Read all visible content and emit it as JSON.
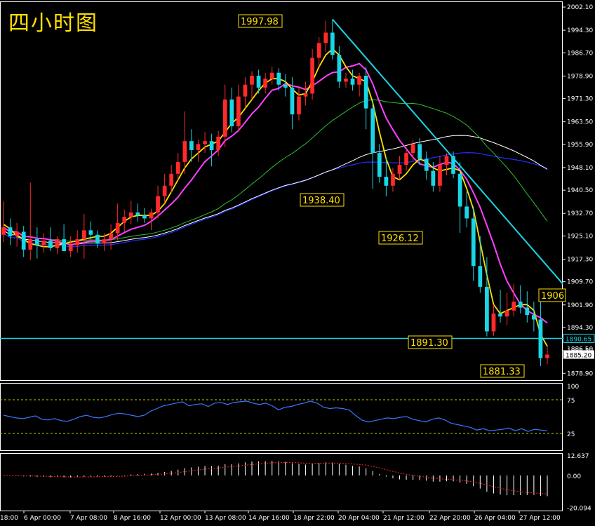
{
  "title": "四小时图",
  "chart_data": {
    "type": "candlestick",
    "timeframe": "4H",
    "main_panel": {
      "y_ticks": [
        2002.1,
        1994.3,
        1986.7,
        1978.9,
        1971.3,
        1963.5,
        1955.9,
        1948.1,
        1940.5,
        1932.7,
        1925.1,
        1917.3,
        1909.7,
        1901.9,
        1894.3,
        1886.5,
        1878.9
      ],
      "y_tick_labels": [
        "2002.10",
        "1994.30",
        "1986.70",
        "1978.90",
        "1971.30",
        "1963.50",
        "1955.90",
        "1948.10",
        "1940.50",
        "1932.70",
        "1925.10",
        "1917.30",
        "1909.70",
        "1901.90",
        "1894.30",
        "1886.50",
        "1878.90"
      ],
      "ylim": [
        1876.6,
        2004.0
      ],
      "x_labels": [
        "6 Apr 00:00",
        "7 Apr 08:00",
        "8 Apr 16:00",
        "12 Apr 00:00",
        "13 Apr 08:00",
        "14 Apr 16:00",
        "18 Apr 22:00",
        "20 Apr 04:00",
        "21 Apr 12:00",
        "22 Apr 20:00",
        "26 Apr 04:00",
        "27 Apr 12:00"
      ],
      "x_label_partial": "18:00",
      "current_price": 1885.2,
      "current_price_label": "1885.20",
      "partial_label": "1886.50",
      "support_line": {
        "value": 1890.65,
        "label": "1890.65"
      },
      "annotations": [
        {
          "label": "1997.98",
          "value": 1997.98
        },
        {
          "label": "1938.40",
          "value": 1938.4
        },
        {
          "label": "1926.12",
          "value": 1926.12
        },
        {
          "label": "1891.30",
          "value": 1891.3
        },
        {
          "label": "1881.33",
          "value": 1881.33
        },
        {
          "label": "1906",
          "value": 1906.5
        }
      ],
      "trendline": {
        "from": 1997.98,
        "to": 1909.0
      },
      "colors": {
        "up": "#ff2a2a",
        "down": "#19d6e6",
        "ma_short": "#ffe000",
        "ma_mid": "#ff40ff",
        "ma_long1": "#2fbf2f",
        "ma_long2": "#ffffff",
        "ma_long3": "#2030ff",
        "trendline": "#19d6e6"
      },
      "candles": [
        [
          1925.5,
          1936.8,
          1923,
          1928
        ],
        [
          1928,
          1931,
          1922,
          1925
        ],
        [
          1925,
          1929.5,
          1921.5,
          1926.5
        ],
        [
          1926.5,
          1928.5,
          1918,
          1920.5
        ],
        [
          1920.5,
          1943,
          1917,
          1924
        ],
        [
          1924,
          1928,
          1917.5,
          1922
        ],
        [
          1922,
          1926,
          1919.5,
          1923.5
        ],
        [
          1923.5,
          1928,
          1920,
          1921
        ],
        [
          1921,
          1925,
          1919,
          1924
        ],
        [
          1924,
          1929,
          1921,
          1920
        ],
        [
          1920,
          1925,
          1918,
          1922
        ],
        [
          1922,
          1927,
          1919.5,
          1924
        ],
        [
          1924,
          1932.5,
          1917.5,
          1927
        ],
        [
          1927,
          1930,
          1924,
          1925.5
        ],
        [
          1925.5,
          1927,
          1921,
          1922.5
        ],
        [
          1922.5,
          1926,
          1920,
          1924
        ],
        [
          1924,
          1929,
          1920.5,
          1926
        ],
        [
          1926,
          1936,
          1923.5,
          1929.5
        ],
        [
          1929.5,
          1934,
          1926.5,
          1931.5
        ],
        [
          1931.5,
          1937,
          1929,
          1933
        ],
        [
          1933,
          1936,
          1930,
          1932
        ],
        [
          1932,
          1934.5,
          1929.5,
          1931
        ],
        [
          1931,
          1934.3,
          1927,
          1933
        ],
        [
          1933,
          1942,
          1931,
          1938.5
        ],
        [
          1938.5,
          1946,
          1936,
          1942
        ],
        [
          1942,
          1949,
          1939.5,
          1946
        ],
        [
          1946,
          1953,
          1944,
          1950
        ],
        [
          1950,
          1967,
          1946,
          1957
        ],
        [
          1957,
          1961,
          1950,
          1954
        ],
        [
          1954,
          1957.5,
          1950,
          1956
        ],
        [
          1956,
          1960,
          1953,
          1957
        ],
        [
          1957,
          1959.5,
          1948.5,
          1954
        ],
        [
          1954,
          1960.5,
          1952,
          1958.5
        ],
        [
          1958.5,
          1976,
          1955,
          1971
        ],
        [
          1971,
          1975,
          1960,
          1962
        ],
        [
          1962,
          1976,
          1960,
          1972
        ],
        [
          1972,
          1978.5,
          1968,
          1976
        ],
        [
          1976,
          1980.5,
          1971,
          1979
        ],
        [
          1979,
          1981,
          1973,
          1975
        ],
        [
          1975,
          1980,
          1973,
          1978
        ],
        [
          1978,
          1982,
          1976,
          1980
        ],
        [
          1980,
          1981.5,
          1974,
          1976
        ],
        [
          1976,
          1979.5,
          1972,
          1975
        ],
        [
          1975,
          1978.5,
          1961,
          1966
        ],
        [
          1966,
          1975,
          1964,
          1972
        ],
        [
          1972,
          1977,
          1969,
          1973
        ],
        [
          1973,
          1988,
          1971,
          1985
        ],
        [
          1985,
          1992,
          1982,
          1990
        ],
        [
          1990,
          1997.5,
          1987,
          1993.5
        ],
        [
          1993.5,
          1997.98,
          1984.5,
          1986
        ],
        [
          1986,
          1989,
          1975,
          1977
        ],
        [
          1977,
          1980,
          1975,
          1978
        ],
        [
          1978,
          1981,
          1974,
          1976
        ],
        [
          1976,
          1980,
          1972,
          1979
        ],
        [
          1979,
          1982,
          1961,
          1968
        ],
        [
          1968,
          1970.5,
          1941,
          1953
        ],
        [
          1953,
          1956,
          1943,
          1945
        ],
        [
          1945,
          1951.5,
          1938.4,
          1942
        ],
        [
          1942,
          1948,
          1940,
          1946
        ],
        [
          1946,
          1952,
          1944,
          1949
        ],
        [
          1949,
          1955,
          1947,
          1953
        ],
        [
          1953,
          1957.5,
          1950.5,
          1956
        ],
        [
          1956,
          1958,
          1949,
          1951
        ],
        [
          1951,
          1953.5,
          1944,
          1947
        ],
        [
          1947,
          1950,
          1940,
          1942
        ],
        [
          1942,
          1952,
          1940,
          1949
        ],
        [
          1949,
          1953,
          1945.5,
          1952
        ],
        [
          1952,
          1953.5,
          1944.5,
          1946
        ],
        [
          1946,
          1950,
          1926.12,
          1935
        ],
        [
          1935,
          1940,
          1928,
          1931
        ],
        [
          1931,
          1935,
          1910,
          1915
        ],
        [
          1915,
          1925,
          1906,
          1908
        ],
        [
          1908,
          1918,
          1891.3,
          1893
        ],
        [
          1893,
          1902,
          1891.5,
          1899
        ],
        [
          1899,
          1907,
          1896,
          1898
        ],
        [
          1898,
          1906,
          1895,
          1900
        ],
        [
          1900,
          1909,
          1898,
          1903
        ],
        [
          1903,
          1908.5,
          1899,
          1901
        ],
        [
          1901,
          1906.5,
          1896,
          1898.5
        ],
        [
          1898.5,
          1903,
          1893,
          1897
        ],
        [
          1897,
          1906.5,
          1881.33,
          1884
        ],
        [
          1884,
          1888,
          1882,
          1885.2
        ]
      ],
      "ma_short": [
        1929,
        1927.5,
        1925,
        1924,
        1922.5,
        1922,
        1921.5,
        1921.5,
        1922,
        1922.5,
        1923,
        1923.5,
        1924,
        1924.5,
        1925,
        1925,
        1926,
        1928,
        1930,
        1931.5,
        1932,
        1932,
        1932,
        1933.5,
        1936,
        1940,
        1944,
        1948,
        1951,
        1953,
        1955,
        1956,
        1957,
        1960,
        1963,
        1965,
        1968,
        1971,
        1974,
        1976.5,
        1978,
        1978,
        1977,
        1974.5,
        1972.5,
        1973,
        1977,
        1982,
        1986,
        1988,
        1986,
        1982,
        1979,
        1978,
        1977,
        1970,
        1960,
        1951,
        1945,
        1944,
        1946,
        1949,
        1951,
        1950,
        1948,
        1947,
        1947.5,
        1948,
        1947,
        1941,
        1934,
        1923,
        1912,
        1902,
        1899,
        1900,
        1901,
        1902,
        1902,
        1900,
        1892,
        1888
      ]
    },
    "rsi_panel": {
      "y_ticks": [
        100,
        75,
        25
      ],
      "y_tick_labels": [
        "100",
        "75",
        "25"
      ],
      "levels": [
        75,
        25
      ],
      "values": [
        52,
        50,
        48,
        47,
        49,
        51,
        46,
        45,
        47,
        44,
        43,
        46,
        50,
        52,
        49,
        48,
        50,
        53,
        55,
        54,
        52,
        50,
        52,
        58,
        62,
        66,
        68,
        70,
        72,
        66,
        68,
        69,
        65,
        70,
        71,
        68,
        71,
        72,
        73,
        70,
        68,
        70,
        66,
        60,
        64,
        65,
        68,
        70,
        73,
        70,
        64,
        62,
        63,
        62,
        60,
        52,
        45,
        42,
        44,
        46,
        48,
        47,
        49,
        50,
        46,
        44,
        42,
        46,
        48,
        45,
        40,
        38,
        36,
        34,
        30,
        32,
        29,
        30,
        31,
        33,
        29,
        32,
        28,
        31,
        30,
        29
      ]
    },
    "macd_panel": {
      "y_ticks": [
        12.637,
        0.0,
        -20.094
      ],
      "y_tick_labels": [
        "12.637",
        "0.00",
        "-20.094"
      ],
      "ylim": [
        -22,
        14
      ]
    }
  }
}
